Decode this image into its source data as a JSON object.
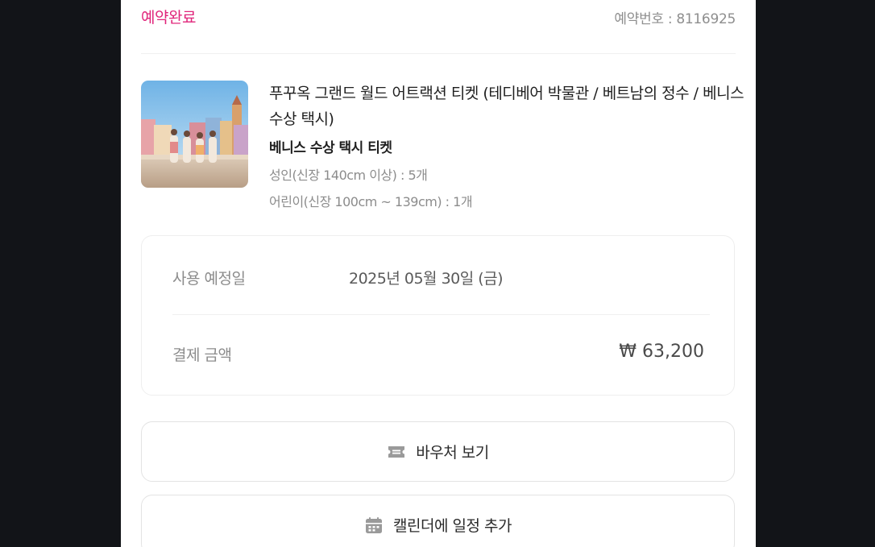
{
  "header": {
    "status": "예약완료",
    "booking_number": "예약번호 : 8116925",
    "status_color": "#e0257b"
  },
  "product": {
    "title": "푸꾸옥 그랜드 월드 어트랙션 티켓 (테디베어 박물관 / 베트남의 정수 / 베니스 수상 택시)",
    "option": "베니스 수상 택시 티켓",
    "quantities": [
      "성인(신장 140cm 이상) : 5개",
      "어린이(신장 100cm ~ 139cm) : 1개"
    ]
  },
  "info": {
    "date_label": "사용 예정일",
    "date_value": "2025년 05월 30일 (금)",
    "amount_label": "결제 금액",
    "amount_value": "₩ 63,200"
  },
  "actions": {
    "voucher": {
      "label": "바우처 보기",
      "icon": "ticket-icon"
    },
    "calendar": {
      "label": "캘린더에 일정 추가",
      "icon": "calendar-icon"
    }
  }
}
